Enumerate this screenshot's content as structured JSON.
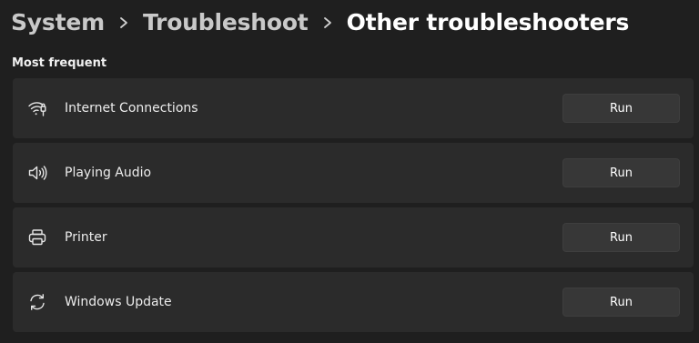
{
  "breadcrumb": {
    "items": [
      "System",
      "Troubleshoot",
      "Other troubleshooters"
    ],
    "separator_icon": "chevron-right-icon"
  },
  "section": {
    "title": "Most frequent"
  },
  "troubleshooters": [
    {
      "label": "Internet Connections",
      "icon": "wifi-icon",
      "button_label": "Run"
    },
    {
      "label": "Playing Audio",
      "icon": "speaker-icon",
      "button_label": "Run"
    },
    {
      "label": "Printer",
      "icon": "printer-icon",
      "button_label": "Run"
    },
    {
      "label": "Windows Update",
      "icon": "sync-icon",
      "button_label": "Run"
    }
  ],
  "colors": {
    "background": "#1f1f1f",
    "card": "#2b2b2b",
    "button": "#373737",
    "text": "#ffffff",
    "breadcrumb_muted": "#c9c9c9"
  }
}
